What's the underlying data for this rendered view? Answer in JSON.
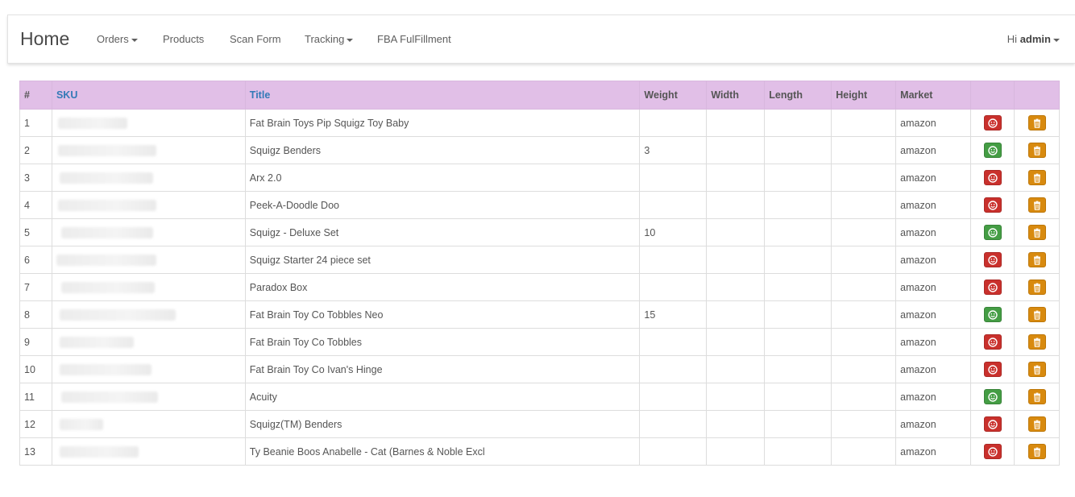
{
  "navbar": {
    "brand": "Home",
    "items": [
      {
        "label": "Orders",
        "dropdown": true
      },
      {
        "label": "Products",
        "dropdown": false
      },
      {
        "label": "Scan Form",
        "dropdown": false
      },
      {
        "label": "Tracking",
        "dropdown": true
      },
      {
        "label": "FBA FulFillment",
        "dropdown": false
      }
    ],
    "user_greeting": "Hi",
    "user_name": "admin"
  },
  "table": {
    "columns": [
      "#",
      "SKU",
      "Title",
      "Weight",
      "Width",
      "Length",
      "Height",
      "Market",
      "",
      ""
    ],
    "rows": [
      {
        "num": "1",
        "title": "Fat Brain Toys Pip Squigz Toy Baby",
        "weight": "",
        "width": "",
        "length": "",
        "height": "",
        "market": "amazon",
        "status": "red"
      },
      {
        "num": "2",
        "title": "Squigz Benders",
        "weight": "3",
        "width": "",
        "length": "",
        "height": "",
        "market": "amazon",
        "status": "green"
      },
      {
        "num": "3",
        "title": "Arx 2.0",
        "weight": "",
        "width": "",
        "length": "",
        "height": "",
        "market": "amazon",
        "status": "red"
      },
      {
        "num": "4",
        "title": "Peek-A-Doodle Doo",
        "weight": "",
        "width": "",
        "length": "",
        "height": "",
        "market": "amazon",
        "status": "red"
      },
      {
        "num": "5",
        "title": "Squigz - Deluxe Set",
        "weight": "10",
        "width": "",
        "length": "",
        "height": "",
        "market": "amazon",
        "status": "green"
      },
      {
        "num": "6",
        "title": "Squigz Starter 24 piece set",
        "weight": "",
        "width": "",
        "length": "",
        "height": "",
        "market": "amazon",
        "status": "red"
      },
      {
        "num": "7",
        "title": "Paradox Box",
        "weight": "",
        "width": "",
        "length": "",
        "height": "",
        "market": "amazon",
        "status": "red"
      },
      {
        "num": "8",
        "title": "Fat Brain Toy Co Tobbles Neo",
        "weight": "15",
        "width": "",
        "length": "",
        "height": "",
        "market": "amazon",
        "status": "green"
      },
      {
        "num": "9",
        "title": "Fat Brain Toy Co Tobbles",
        "weight": "",
        "width": "",
        "length": "",
        "height": "",
        "market": "amazon",
        "status": "red"
      },
      {
        "num": "10",
        "title": "Fat Brain Toy Co Ivan's Hinge",
        "weight": "",
        "width": "",
        "length": "",
        "height": "",
        "market": "amazon",
        "status": "red"
      },
      {
        "num": "11",
        "title": "Acuity",
        "weight": "",
        "width": "",
        "length": "",
        "height": "",
        "market": "amazon",
        "status": "green"
      },
      {
        "num": "12",
        "title": "Squigz(TM) Benders",
        "weight": "",
        "width": "",
        "length": "",
        "height": "",
        "market": "amazon",
        "status": "red"
      },
      {
        "num": "13",
        "title": "Ty Beanie Boos Anabelle - Cat (Barnes & Noble Excl",
        "weight": "",
        "width": "",
        "length": "",
        "height": "",
        "market": "amazon",
        "status": "red"
      }
    ]
  },
  "colors": {
    "header_bg": "#e1bfe7",
    "link": "#337ab7",
    "status_red": "#c9302c",
    "status_green": "#449d44",
    "delete_orange": "#d88a0f"
  },
  "icons": {
    "status": "smile-icon",
    "delete": "trash-icon"
  }
}
